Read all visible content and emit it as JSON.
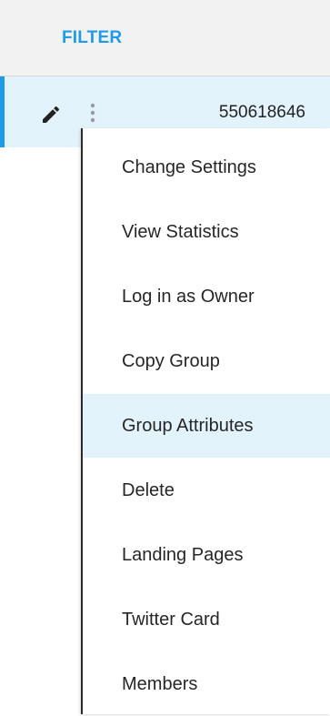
{
  "header": {
    "filter_label": "FILTER"
  },
  "row": {
    "id": "550618646",
    "edit_icon": "pencil-icon",
    "more_icon": "more-vertical-icon"
  },
  "menu": {
    "items": [
      {
        "label": "Change Settings"
      },
      {
        "label": "View Statistics"
      },
      {
        "label": "Log in as Owner"
      },
      {
        "label": "Copy Group"
      },
      {
        "label": "Group Attributes",
        "highlighted": true
      },
      {
        "label": "Delete"
      },
      {
        "label": "Landing Pages"
      },
      {
        "label": "Twitter Card"
      },
      {
        "label": "Members"
      }
    ]
  },
  "colors": {
    "accent": "#1e9be8",
    "highlight": "#e3f3fc",
    "header_bg": "#f2f2f2",
    "text": "#262626"
  }
}
